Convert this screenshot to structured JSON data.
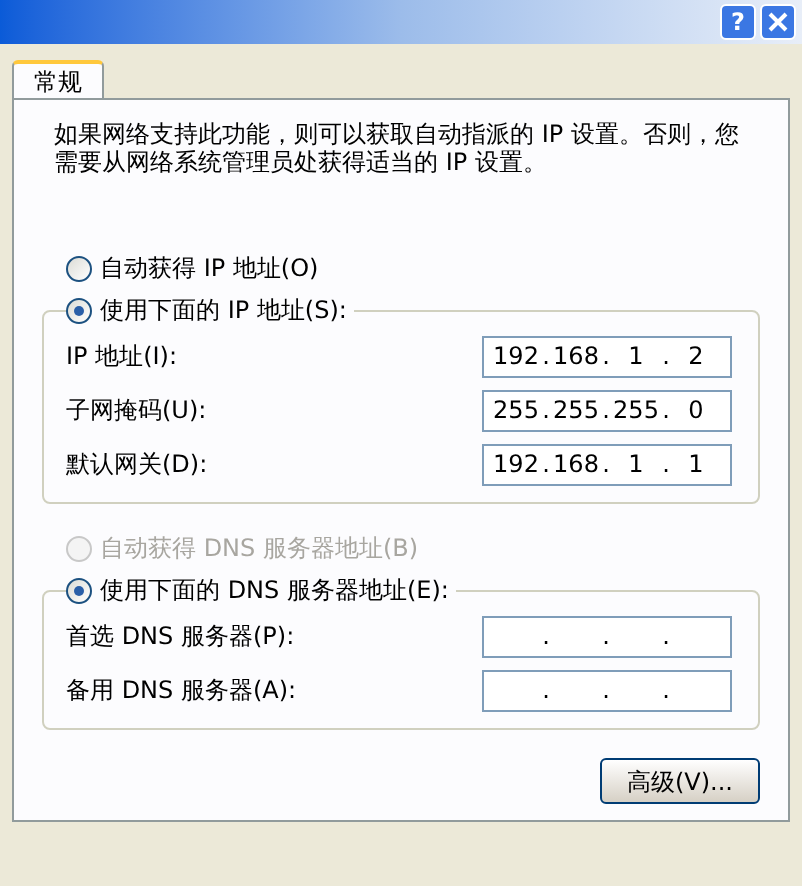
{
  "title_bar": {
    "help": "?"
  },
  "tabs": [
    {
      "label": "常规",
      "selected": true
    }
  ],
  "description": "如果网络支持此功能，则可以获取自动指派的 IP 设置。否则，您需要从网络系统管理员处获得适当的 IP 设置。",
  "separator": ".",
  "sections": [
    {
      "auto_option": {
        "label": "自动获得 IP 地址(O)",
        "selected": false,
        "disabled": false
      },
      "manual_option": {
        "label": "使用下面的 IP 地址(S):",
        "selected": true,
        "disabled": false
      },
      "fields": [
        {
          "label": "IP 地址(I):",
          "octets": [
            "192",
            "168",
            "1",
            "2"
          ]
        },
        {
          "label": "子网掩码(U):",
          "octets": [
            "255",
            "255",
            "255",
            "0"
          ]
        },
        {
          "label": "默认网关(D):",
          "octets": [
            "192",
            "168",
            "1",
            "1"
          ]
        }
      ]
    },
    {
      "auto_option": {
        "label": "自动获得 DNS 服务器地址(B)",
        "selected": false,
        "disabled": true
      },
      "manual_option": {
        "label": "使用下面的 DNS 服务器地址(E):",
        "selected": true,
        "disabled": false
      },
      "fields": [
        {
          "label": "首选 DNS 服务器(P):"
        },
        {
          "label": "备用 DNS 服务器(A):"
        }
      ]
    }
  ],
  "advanced_button": "高级(V)..."
}
